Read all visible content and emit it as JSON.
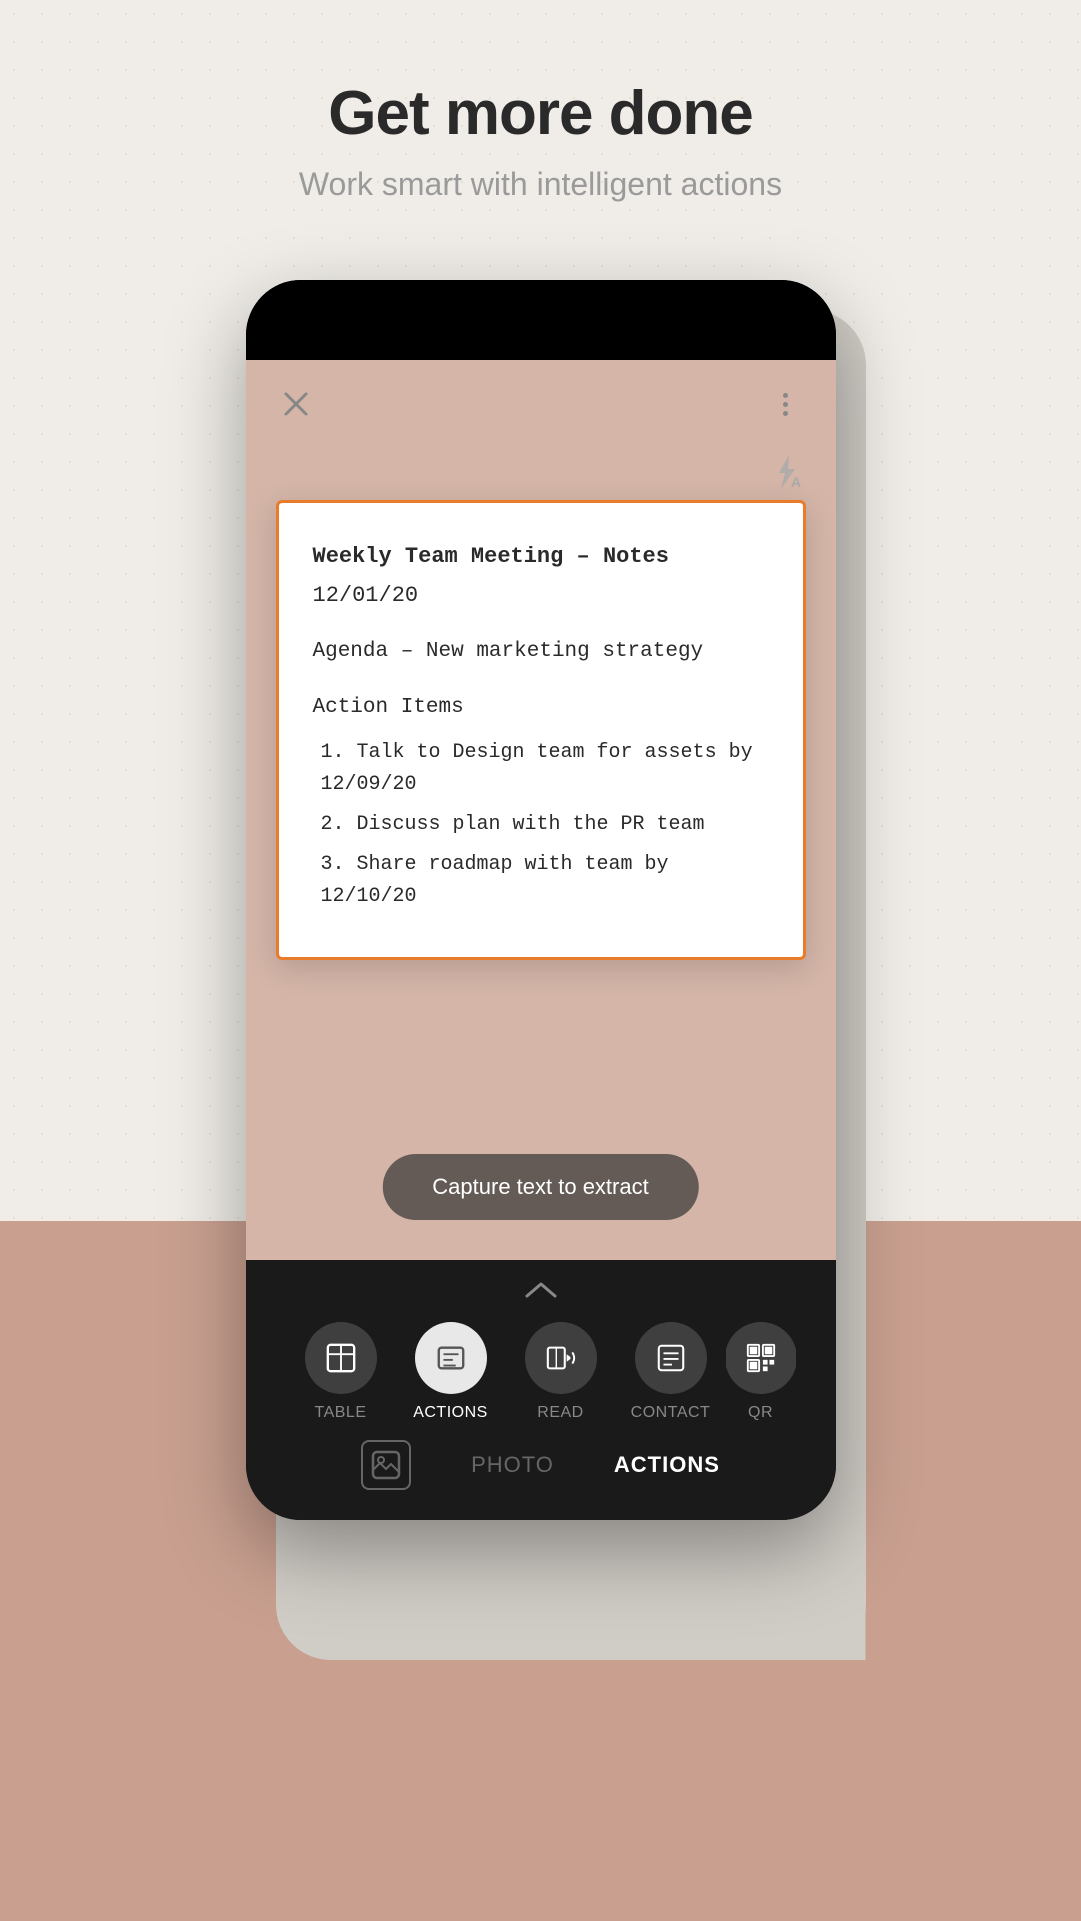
{
  "header": {
    "title": "Get more done",
    "subtitle": "Work smart with intelligent actions"
  },
  "camera": {
    "close_icon": "×",
    "more_icon": "⋮",
    "flash_icon": "⚡A",
    "document": {
      "title": "Weekly Team Meeting – Notes",
      "date": "12/01/20",
      "agenda": "Agenda – New marketing strategy",
      "section_title": "Action Items",
      "items": [
        "1. Talk to Design team for assets by 12/09/20",
        "2. Discuss plan with the PR team",
        "3. Share roadmap with team by 12/10/20"
      ]
    },
    "capture_button": "Capture text to extract"
  },
  "bottom_bar": {
    "up_arrow": "^",
    "modes": [
      {
        "id": "table",
        "label": "TABLE",
        "active": false
      },
      {
        "id": "actions",
        "label": "ACTIONS",
        "active": true
      },
      {
        "id": "read",
        "label": "READ",
        "active": false
      },
      {
        "id": "contact",
        "label": "CONTACT",
        "active": false
      },
      {
        "id": "qr",
        "label": "QR",
        "active": false
      }
    ],
    "tabs": [
      {
        "id": "photo",
        "label": "PHOTO",
        "active": false
      },
      {
        "id": "actions",
        "label": "ACTIONS",
        "active": true
      }
    ]
  }
}
